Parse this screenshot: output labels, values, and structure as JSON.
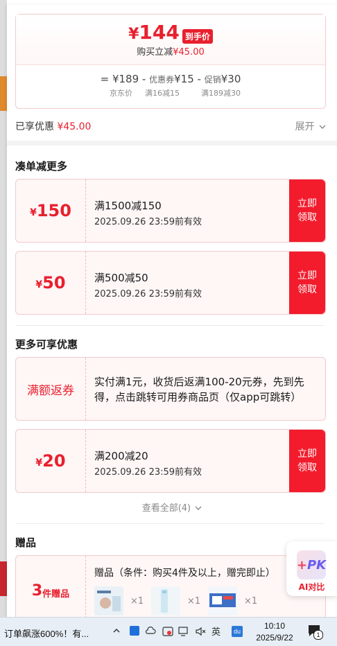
{
  "price_card": {
    "currency": "¥",
    "final_price": "144",
    "final_badge": "到手价",
    "savings_label": "购买立减",
    "savings_amount": "¥45.00",
    "formula": {
      "eq": "=",
      "jd_price": "¥189",
      "minus1": "-",
      "coupon_label": "优惠券",
      "coupon_value": "¥15",
      "minus2": "-",
      "promo_label": "促销",
      "promo_value": "¥30"
    },
    "formula_sub": {
      "jd_price_label": "京东价",
      "coupon_rule": "满16减15",
      "promo_rule": "满189减30"
    }
  },
  "enjoyed": {
    "label": "已享优惠",
    "amount": "¥45.00",
    "expand_label": "展开"
  },
  "sections": {
    "more_discount_title": "凑单减更多",
    "more_available_title": "更多可享优惠",
    "gifts_title": "赠品"
  },
  "coupons_more": [
    {
      "currency": "¥",
      "amount": "150",
      "rule": "满1500减150",
      "expiry": "2025.09.26 23:59前有效",
      "button_line1": "立即",
      "button_line2": "领取"
    },
    {
      "currency": "¥",
      "amount": "50",
      "rule": "满500减50",
      "expiry": "2025.09.26 23:59前有效",
      "button_line1": "立即",
      "button_line2": "领取"
    }
  ],
  "cashback": {
    "left_label": "满额返券",
    "text": "实付满1元，收货后返满100-20元券，先到先得，点击跳转可用券商品页（仅app可跳转）"
  },
  "coupon_available": {
    "currency": "¥",
    "amount": "20",
    "rule": "满200减20",
    "expiry": "2025.09.26 23:59前有效",
    "button_line1": "立即",
    "button_line2": "领取"
  },
  "view_all": "查看全部(4)",
  "gift": {
    "count": "3",
    "count_unit": "件赠品",
    "desc": "赠品（条件：购买4件及以上，赠完即止）",
    "items": [
      {
        "qty": "×1"
      },
      {
        "qty": "×1"
      },
      {
        "qty": "×1"
      }
    ]
  },
  "pk_float": {
    "icon_plus": "+",
    "icon_text": "PK",
    "label": "AI对比"
  },
  "taskbar": {
    "news": "订单飙涨600%！有...",
    "time": "10:10",
    "date": "2025/9/22",
    "notification_count": "1",
    "ime_label": "英"
  },
  "colors": {
    "accent": "#e8202e",
    "button": "#f21c2d",
    "coupon_bg": "#fff6f6"
  }
}
